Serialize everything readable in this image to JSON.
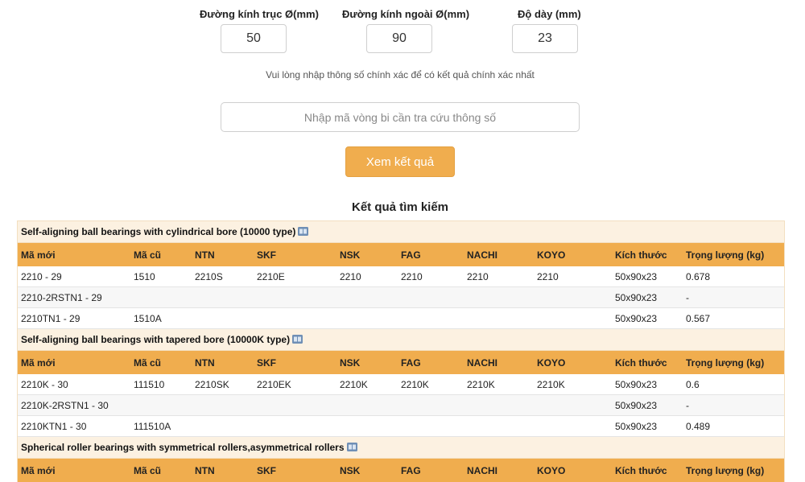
{
  "form": {
    "shaft_label": "Đường kính trục Ø(mm)",
    "shaft_value": "50",
    "outer_label": "Đường kính ngoài Ø(mm)",
    "outer_value": "90",
    "width_label": "Độ dày (mm)",
    "width_value": "23",
    "hint": "Vui lòng nhập thông số chính xác để có kết quả chính xác nhất",
    "code_placeholder": "Nhập mã vòng bi cần tra cứu thông số",
    "code_value": "",
    "submit_label": "Xem kết quả"
  },
  "results": {
    "title": "Kết quả tìm kiếm",
    "columns": [
      "Mã mới",
      "Mã cũ",
      "NTN",
      "SKF",
      "NSK",
      "FAG",
      "NACHI",
      "KOYO",
      "Kích thước",
      "Trọng lượng (kg)"
    ],
    "sections": [
      {
        "title": "Self-aligning ball bearings with cylindrical bore (10000 type)",
        "icon": "book-icon",
        "rows": [
          [
            "2210 - 29",
            "1510",
            "2210S",
            "2210E",
            "2210",
            "2210",
            "2210",
            "2210",
            "50x90x23",
            "0.678"
          ],
          [
            "2210-2RSTN1 - 29",
            "",
            "",
            "",
            "",
            "",
            "",
            "",
            "50x90x23",
            "-"
          ],
          [
            "2210TN1 - 29",
            "1510A",
            "",
            "",
            "",
            "",
            "",
            "",
            "50x90x23",
            "0.567"
          ]
        ]
      },
      {
        "title": "Self-aligning ball bearings with tapered bore (10000K type)",
        "icon": "book-icon",
        "rows": [
          [
            "2210K - 30",
            "111510",
            "2210SK",
            "2210EK",
            "2210K",
            "2210K",
            "2210K",
            "2210K",
            "50x90x23",
            "0.6"
          ],
          [
            "2210K-2RSTN1 - 30",
            "",
            "",
            "",
            "",
            "",
            "",
            "",
            "50x90x23",
            "-"
          ],
          [
            "2210KTN1 - 30",
            "111510A",
            "",
            "",
            "",
            "",
            "",
            "",
            "50x90x23",
            "0.489"
          ]
        ]
      },
      {
        "title": "Spherical roller bearings with symmetrical rollers,asymmetrical rollers",
        "icon": "book-icon",
        "rows": []
      }
    ]
  },
  "colors": {
    "accent": "#f0ad4e",
    "section_bg": "#fcf1e1"
  }
}
